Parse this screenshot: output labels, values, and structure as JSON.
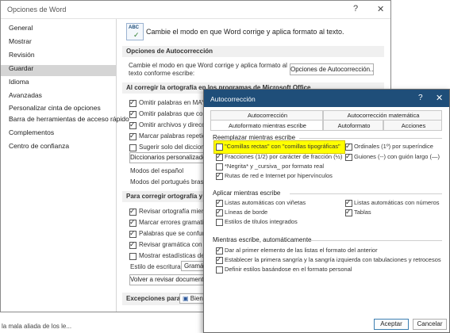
{
  "word_options": {
    "title": "Opciones de Word",
    "help": "?",
    "close": "✕",
    "nav": [
      "General",
      "Mostrar",
      "Revisión",
      "Guardar",
      "Idioma",
      "Avanzadas",
      "Personalizar cinta de opciones",
      "Barra de herramientas de acceso rápido",
      "Complementos",
      "Centro de confianza"
    ],
    "selected_nav": "Revisión",
    "header_text": "Cambie el modo en que Word corrige y aplica formato al texto.",
    "header_icon_text": "ABC",
    "sec_autocorrect": "Opciones de Autocorrección",
    "autocorrect_desc_1": "Cambie el modo en que Word corrige y aplica formato al",
    "autocorrect_desc_2": "texto conforme escribe:",
    "autocorrect_button": "Opciones de Autocorrección...",
    "sec_office": "Al corregir la ortografía en los programas de Microsoft Office",
    "office_opts": [
      {
        "label": "Omitir palabras en MAYÚS",
        "checked": true
      },
      {
        "label": "Omitir palabras que conten",
        "checked": true
      },
      {
        "label": "Omitir archivos y direccion",
        "checked": true
      },
      {
        "label": "Marcar palabras repetidas",
        "checked": true
      },
      {
        "label": "Sugerir solo del diccionario",
        "checked": false
      }
    ],
    "dictionaries_button": "Diccionarios personalizados...",
    "mode_spanish": "Modos del español",
    "mode_portuguese": "Modos del portugués brasileño",
    "sec_word": "Para corregir ortografía y gram",
    "word_opts": [
      {
        "label": "Revisar ortografía mientras",
        "checked": true
      },
      {
        "label": "Marcar errores gramaticale",
        "checked": true
      },
      {
        "label": "Palabras que se confunden",
        "checked": true
      },
      {
        "label": "Revisar gramática con orto",
        "checked": true
      },
      {
        "label": "Mostrar estadísticas de leg",
        "checked": false
      }
    ],
    "writing_style_label": "Estilo de escritura:",
    "writing_style_value": "Gramátic",
    "recheck_button": "Volver a revisar documento",
    "exceptions_label": "Excepciones para:",
    "exceptions_value": "Bienv"
  },
  "bottom_text": "la mala aliada de los le...",
  "autocorrect": {
    "title": "Autocorrección",
    "help": "?",
    "close": "✕",
    "tabs_row1": [
      "Autocorrección",
      "Autocorrección matemática"
    ],
    "tabs_row2": [
      "Autoformato mientras escribe",
      "Autoformato",
      "Acciones"
    ],
    "active_tab": "Autoformato mientras escribe",
    "group1": "Reemplazar mientras escribe",
    "replace_left": [
      {
        "label": "\"Comillas rectas\" con \"comillas tipográficas\"",
        "checked": false
      },
      {
        "label": "Fracciones (1/2) por carácter de fracción (½)",
        "checked": true
      },
      {
        "label": "*Negrita* y _cursiva_ por formato real",
        "checked": false
      },
      {
        "label": "Rutas de red e Internet por hipervínculos",
        "checked": true
      }
    ],
    "replace_right": [
      {
        "label": "Ordinales (1º) por superíndice",
        "checked": true
      },
      {
        "label": "Guiones (--) con guión largo (—)",
        "checked": true
      }
    ],
    "group2": "Aplicar mientras escribe",
    "apply_left": [
      {
        "label": "Listas automáticas con viñetas",
        "checked": true
      },
      {
        "label": "Líneas de borde",
        "checked": true
      },
      {
        "label": "Estilos de títulos integrados",
        "checked": false
      }
    ],
    "apply_right": [
      {
        "label": "Listas automáticas con números",
        "checked": true
      },
      {
        "label": "Tablas",
        "checked": true
      }
    ],
    "group3": "Mientras escribe, automáticamente",
    "auto_opts": [
      {
        "label": "Dar al primer elemento de las listas el formato del anterior",
        "checked": true
      },
      {
        "label": "Establecer la primera sangría y la sangría izquierda con tabulaciones y retrocesos",
        "checked": true
      },
      {
        "label": "Definir estilos basándose en el formato personal",
        "checked": false
      }
    ],
    "ok_button": "Aceptar",
    "cancel_button": "Cancelar"
  }
}
